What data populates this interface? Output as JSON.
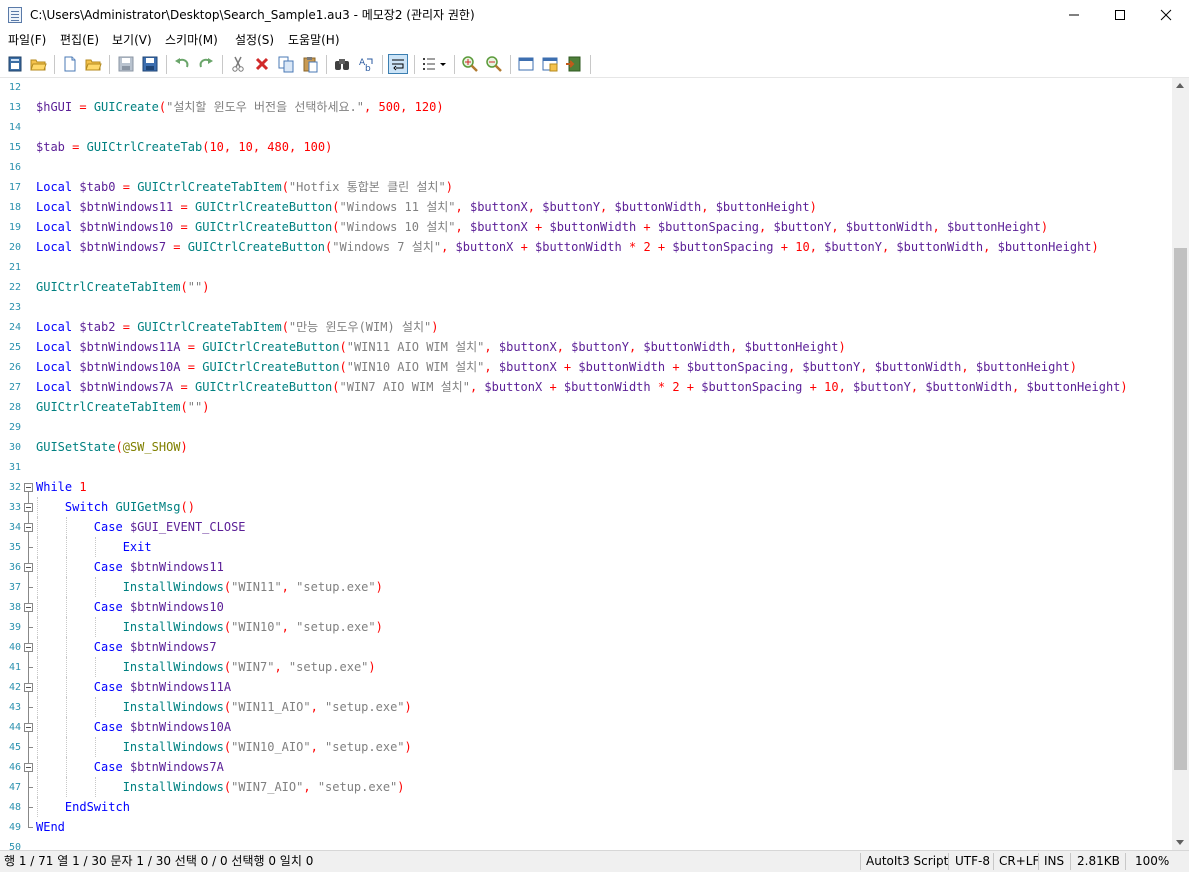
{
  "window": {
    "title": "C:\\Users\\Administrator\\Desktop\\Search_Sample1.au3 - 메모장2 (관리자 권한)"
  },
  "menu": [
    "파일(F)",
    "편집(E)",
    "보기(V)",
    "스키마(M)",
    "설정(S)",
    "도움말(H)"
  ],
  "toolbar": {
    "buttons": [
      "new-file",
      "open-file",
      "new",
      "open",
      "save",
      "save-all",
      "undo",
      "redo",
      "cut",
      "delete",
      "copy",
      "paste",
      "find",
      "replace",
      "word-wrap",
      "bookmarks",
      "zoom-in",
      "zoom-out",
      "scheme",
      "customize",
      "exit"
    ]
  },
  "editor": {
    "lines": [
      {
        "n": "12",
        "code": ""
      },
      {
        "n": "13",
        "code": "$hGUI = GUICreate(\"설치할 윈도우 버전을 선택하세요.\", 500, 120)"
      },
      {
        "n": "14",
        "code": ""
      },
      {
        "n": "15",
        "code": "$tab = GUICtrlCreateTab(10, 10, 480, 100)"
      },
      {
        "n": "16",
        "code": ""
      },
      {
        "n": "17",
        "code": "Local $tab0 = GUICtrlCreateTabItem(\"Hotfix 통합본 클린 설치\")"
      },
      {
        "n": "18",
        "code": "Local $btnWindows11 = GUICtrlCreateButton(\"Windows 11 설치\", $buttonX, $buttonY, $buttonWidth, $buttonHeight)"
      },
      {
        "n": "19",
        "code": "Local $btnWindows10 = GUICtrlCreateButton(\"Windows 10 설치\", $buttonX + $buttonWidth + $buttonSpacing, $buttonY, $buttonWidth, $buttonHeight)"
      },
      {
        "n": "20",
        "code": "Local $btnWindows7 = GUICtrlCreateButton(\"Windows 7 설치\", $buttonX + $buttonWidth * 2 + $buttonSpacing + 10, $buttonY, $buttonWidth, $buttonHeight)"
      },
      {
        "n": "21",
        "code": ""
      },
      {
        "n": "22",
        "code": "GUICtrlCreateTabItem(\"\")"
      },
      {
        "n": "23",
        "code": ""
      },
      {
        "n": "24",
        "code": "Local $tab2 = GUICtrlCreateTabItem(\"만능 윈도우(WIM) 설치\")"
      },
      {
        "n": "25",
        "code": "Local $btnWindows11A = GUICtrlCreateButton(\"WIN11 AIO WIM 설치\", $buttonX, $buttonY, $buttonWidth, $buttonHeight)"
      },
      {
        "n": "26",
        "code": "Local $btnWindows10A = GUICtrlCreateButton(\"WIN10 AIO WIM 설치\", $buttonX + $buttonWidth + $buttonSpacing, $buttonY, $buttonWidth, $buttonHeight)"
      },
      {
        "n": "27",
        "code": "Local $btnWindows7A = GUICtrlCreateButton(\"WIN7 AIO WIM 설치\", $buttonX + $buttonWidth * 2 + $buttonSpacing + 10, $buttonY, $buttonWidth, $buttonHeight)"
      },
      {
        "n": "28",
        "code": "GUICtrlCreateTabItem(\"\")"
      },
      {
        "n": "29",
        "code": ""
      },
      {
        "n": "30",
        "code": "GUISetState(@SW_SHOW)"
      },
      {
        "n": "31",
        "code": ""
      },
      {
        "n": "32",
        "code": "While 1"
      },
      {
        "n": "33",
        "code": "    Switch GUIGetMsg()"
      },
      {
        "n": "34",
        "code": "        Case $GUI_EVENT_CLOSE"
      },
      {
        "n": "35",
        "code": "            Exit"
      },
      {
        "n": "36",
        "code": "        Case $btnWindows11"
      },
      {
        "n": "37",
        "code": "            InstallWindows(\"WIN11\", \"setup.exe\")"
      },
      {
        "n": "38",
        "code": "        Case $btnWindows10"
      },
      {
        "n": "39",
        "code": "            InstallWindows(\"WIN10\", \"setup.exe\")"
      },
      {
        "n": "40",
        "code": "        Case $btnWindows7"
      },
      {
        "n": "41",
        "code": "            InstallWindows(\"WIN7\", \"setup.exe\")"
      },
      {
        "n": "42",
        "code": "        Case $btnWindows11A"
      },
      {
        "n": "43",
        "code": "            InstallWindows(\"WIN11_AIO\", \"setup.exe\")"
      },
      {
        "n": "44",
        "code": "        Case $btnWindows10A"
      },
      {
        "n": "45",
        "code": "            InstallWindows(\"WIN10_AIO\", \"setup.exe\")"
      },
      {
        "n": "46",
        "code": "        Case $btnWindows7A"
      },
      {
        "n": "47",
        "code": "            InstallWindows(\"WIN7_AIO\", \"setup.exe\")"
      },
      {
        "n": "48",
        "code": "    EndSwitch"
      },
      {
        "n": "49",
        "code": "WEnd"
      },
      {
        "n": "50",
        "code": ""
      }
    ],
    "fold_markers": [
      "32",
      "33",
      "34",
      "36",
      "38",
      "40",
      "42",
      "44",
      "46"
    ]
  },
  "status": {
    "position": "행 1 / 71  열 1 / 30  문자 1 / 30  선택 0 / 0  선택행 0  일치 0",
    "scheme": "AutoIt3 Script",
    "encoding": "UTF-8",
    "eol": "CR+LF",
    "mode": "INS",
    "size": "2.81KB",
    "zoom": "100%"
  },
  "colors": {
    "keyword": "#0000ff",
    "function": "#008080",
    "variable": "#5a1e96",
    "string": "#808080",
    "number": "#ff0000",
    "macro": "#808000",
    "line_number": "#2b91af"
  }
}
